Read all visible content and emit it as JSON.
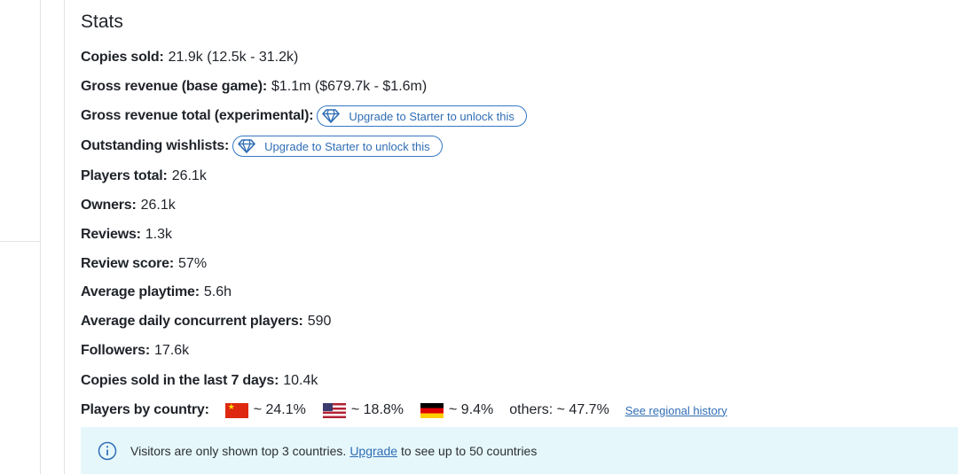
{
  "stats": {
    "title": "Stats",
    "copies_sold": {
      "label": "Copies sold:",
      "value": "21.9k (12.5k - 31.2k)"
    },
    "gross_revenue_base": {
      "label": "Gross revenue (base game):",
      "value": "$1.1m ($679.7k - $1.6m)"
    },
    "gross_revenue_total": {
      "label": "Gross revenue total (experimental):",
      "upgrade": "Upgrade to Starter to unlock this"
    },
    "outstanding_wishlists": {
      "label": "Outstanding wishlists:",
      "upgrade": "Upgrade to Starter to unlock this"
    },
    "players_total": {
      "label": "Players total:",
      "value": "26.1k"
    },
    "owners": {
      "label": "Owners:",
      "value": "26.1k"
    },
    "reviews": {
      "label": "Reviews:",
      "value": "1.3k"
    },
    "review_score": {
      "label": "Review score:",
      "value": "57%"
    },
    "average_playtime": {
      "label": "Average playtime:",
      "value": "5.6h"
    },
    "average_ccu": {
      "label": "Average daily concurrent players:",
      "value": "590"
    },
    "followers": {
      "label": "Followers:",
      "value": "17.6k"
    },
    "copies_last_7": {
      "label": "Copies sold in the last 7 days:",
      "value": "10.4k"
    },
    "players_by_country": {
      "label": "Players by country:",
      "countries": [
        {
          "flag": "china-flag",
          "share": "~ 24.1%"
        },
        {
          "flag": "usa-flag",
          "share": "~ 18.8%"
        },
        {
          "flag": "germany-flag",
          "share": "~ 9.4%"
        }
      ],
      "others": "others: ~ 47.7%",
      "history_link": "See regional history"
    }
  },
  "notice": {
    "icon": "info-icon",
    "before": "Visitors are only shown top 3 countries.",
    "link": "Upgrade",
    "after": "to see up to 50 countries"
  },
  "colors": {
    "accent": "#2f6db5",
    "notice_bg": "#e6f7fb",
    "border": "#e3e3e3"
  }
}
